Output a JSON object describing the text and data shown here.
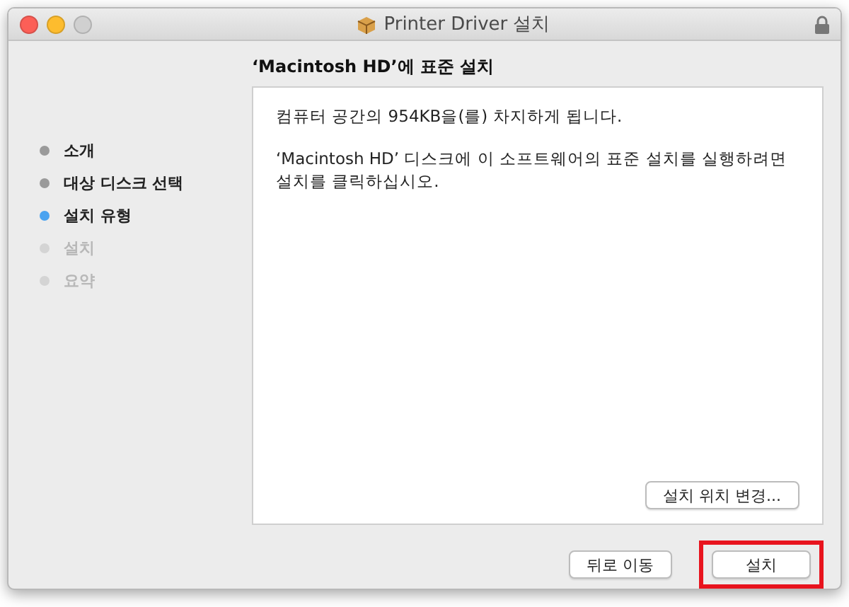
{
  "window": {
    "title": "Printer Driver 설치"
  },
  "heading": "‘Macintosh HD’에 표준 설치",
  "steps": [
    {
      "label": "소개",
      "selected": false,
      "disabled": false
    },
    {
      "label": "대상 디스크 선택",
      "selected": false,
      "disabled": false
    },
    {
      "label": "설치 유형",
      "selected": true,
      "disabled": false
    },
    {
      "label": "설치",
      "selected": false,
      "disabled": true
    },
    {
      "label": "요약",
      "selected": false,
      "disabled": true
    }
  ],
  "content": {
    "paragraphs": [
      "컴퓨터 공간의 954KB을(를) 차지하게 됩니다.",
      "‘Macintosh HD’ 디스크에 이 소프트웨어의 표준 설치를 실행하려면 설치를 클릭하십시오."
    ],
    "change_location_button": "설치 위치 변경..."
  },
  "buttons": [
    {
      "label": "뒤로 이동",
      "highlighted": false
    },
    {
      "label": "설치",
      "highlighted": true
    }
  ]
}
